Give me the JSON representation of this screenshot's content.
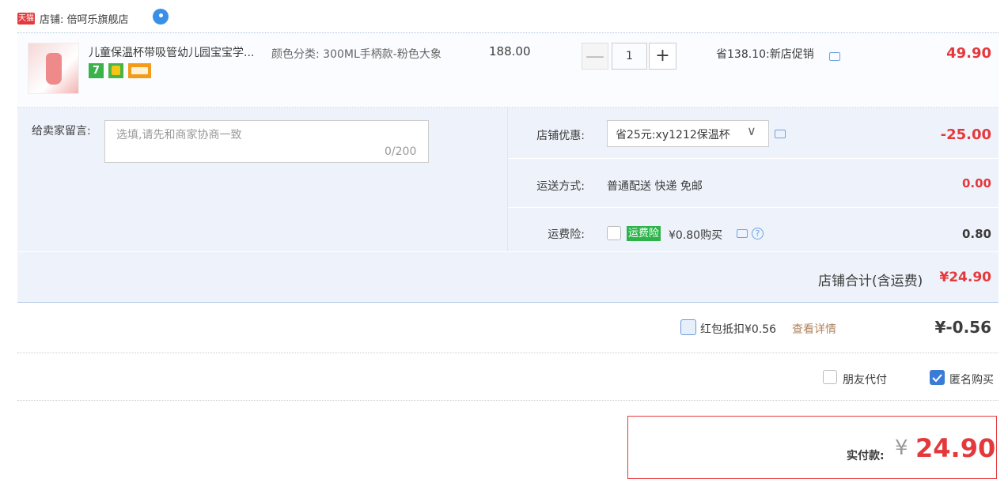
{
  "shop": {
    "badge": "天猫",
    "title": "店铺: 倍呵乐旗舰店"
  },
  "item": {
    "title": "儿童保温杯带吸管幼儿园宝宝学...",
    "sku": "颜色分类: 300ML手柄款-粉色大象",
    "price": "188.00",
    "quantity": "1",
    "minus": "—",
    "plus": "+",
    "saving": "省138.10:新店促销",
    "total": "49.90",
    "badge_icons": [
      "seven-day-return-icon",
      "certified-icon",
      "card-payment-icon"
    ]
  },
  "message": {
    "label": "给卖家留言:",
    "placeholder": "选填,请先和商家协商一致",
    "count": "0/200"
  },
  "coupon": {
    "label": "店铺优惠:",
    "value": "省25元:xy1212保温杯",
    "amount": "-25.00"
  },
  "shipping": {
    "label": "运送方式:",
    "value": "普通配送 快递 免邮",
    "amount": "0.00"
  },
  "insurance": {
    "label": "运费险:",
    "tag": "运费险",
    "price": "¥0.80购买",
    "amount": "0.80",
    "help": "?"
  },
  "shop_total": {
    "label": "店铺合计(含运费)",
    "value": "¥24.90"
  },
  "redpacket": {
    "label": "红包抵扣¥0.56",
    "link": "查看详情",
    "value": "¥-0.56"
  },
  "options": {
    "friend_pay": "朋友代付",
    "anonymous": "匿名购买",
    "anonymous_checked": true,
    "friend_pay_checked": false
  },
  "payment": {
    "label": "实付款:",
    "currency": "¥",
    "value": "24.90"
  },
  "colors": {
    "accent": "#e4393c",
    "insurance_tag": "#2eb34b",
    "check_blue": "#3a7bd5",
    "option_bg": "#eef3fb"
  }
}
